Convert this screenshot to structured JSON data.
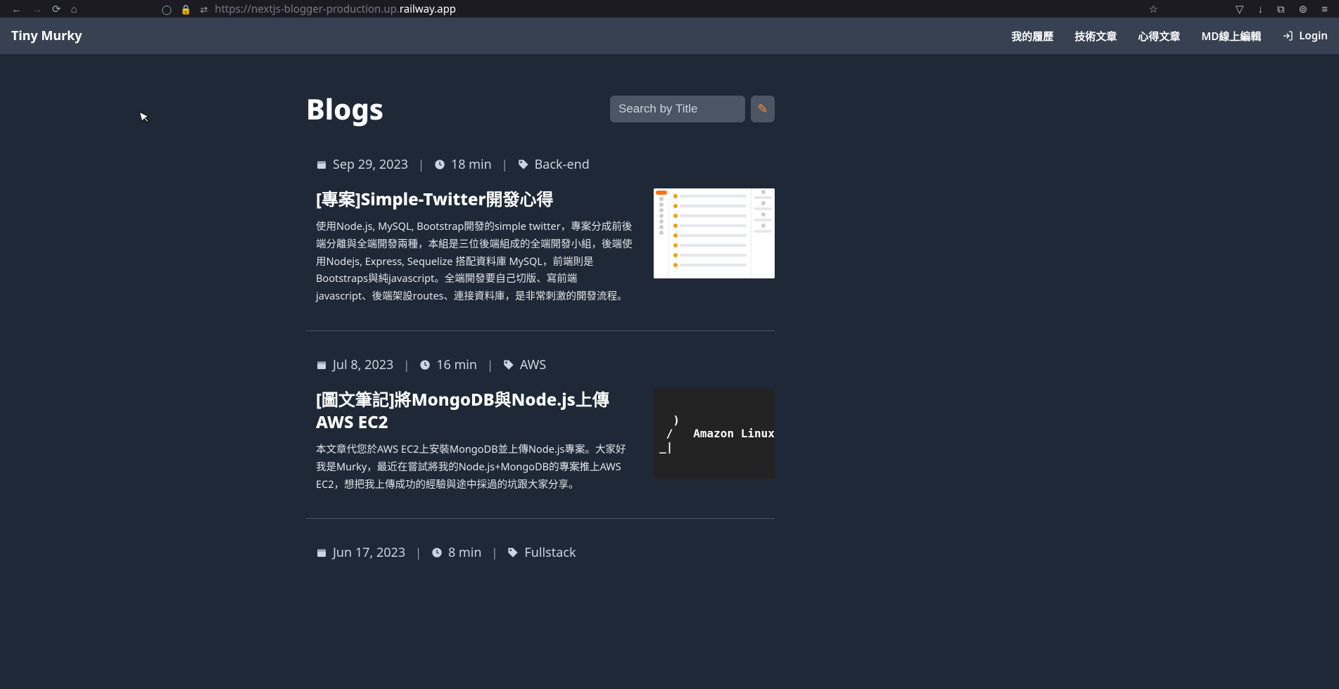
{
  "browser": {
    "url_full": "https://nextjs-blogger-production.up.railway.app",
    "url_prefix": "https://nextjs-blogger-production.up.",
    "url_highlight": "railway.app"
  },
  "header": {
    "brand": "Tiny Murky",
    "nav": {
      "resume": "我的履歷",
      "tech": "技術文章",
      "thoughts": "心得文章",
      "md_editor": "MD線上編輯",
      "login": "Login"
    }
  },
  "page": {
    "title": "Blogs",
    "search_placeholder": "Search by Title"
  },
  "posts": [
    {
      "date": "Sep 29, 2023",
      "read": "18 min",
      "tag": "Back-end",
      "title": "[專案]Simple-Twitter開發心得",
      "desc": "使用Node.js, MySQL, Bootstrap開發的simple twitter，專案分成前後端分離與全端開發兩種，本組是三位後端組成的全端開發小組，後端使用Nodejs, Express, Sequelize 搭配資料庫 MySQL，前端則是Bootstraps與純javascript。全端開發要自己切版、寫前端javascript、後端架設routes、連接資料庫，是非常刺激的開發流程。"
    },
    {
      "date": "Jul 8, 2023",
      "read": "16 min",
      "tag": "AWS",
      "title": "[圖文筆記]將MongoDB與Node.js上傳AWS EC2",
      "desc": "本文章代您於AWS EC2上安裝MongoDB並上傳Node.js專案。大家好我是Murky，最近在嘗試將我的Node.js+MongoDB的專案推上AWS EC2，想把我上傳成功的經驗與途中採過的坑跟大家分享。",
      "thumb_text": "  )\n /   Amazon Linux\n_|"
    },
    {
      "date": "Jun 17, 2023",
      "read": "8 min",
      "tag": "Fullstack",
      "title": "",
      "desc": ""
    }
  ]
}
